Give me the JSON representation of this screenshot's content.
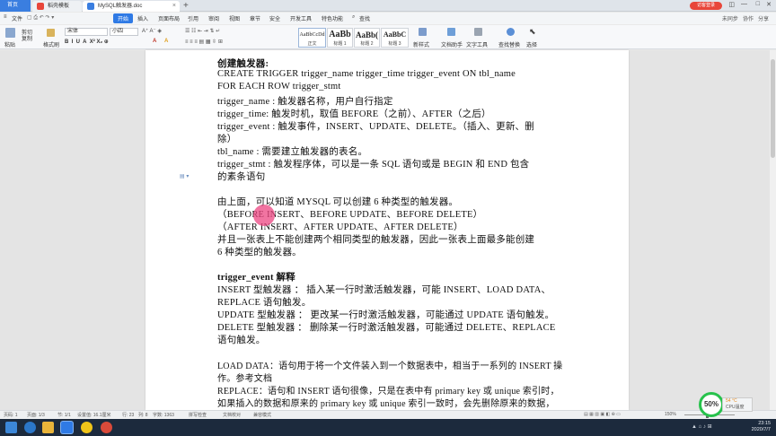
{
  "tabs": {
    "home": "首页",
    "template": "稻壳模板",
    "document": "MySQL触发器.doc"
  },
  "window": {
    "badge": "访客登录"
  },
  "menu": {
    "file": "文件",
    "items": [
      "开始",
      "插入",
      "页面布局",
      "引用",
      "审阅",
      "视图",
      "章节",
      "安全",
      "开发工具",
      "特色功能"
    ],
    "search": "查找",
    "right": [
      "未同步",
      "协作",
      "分享"
    ]
  },
  "ribbon": {
    "paste": "粘贴",
    "cut": "剪切",
    "copy": "复制",
    "format_painter": "格式刷",
    "font_name": "宋体",
    "font_size": "小四",
    "styles": [
      {
        "sample": "AaBbCcDd",
        "name": "正文"
      },
      {
        "sample": "AaBb",
        "name": "标题 1"
      },
      {
        "sample": "AaBb(",
        "name": "标题 2"
      },
      {
        "sample": "AaBbC",
        "name": "标题 3"
      }
    ],
    "new_style": "新样式",
    "doc_assistant": "文档助手",
    "text_tools": "文字工具",
    "find_replace": "查找替换",
    "select": "选择"
  },
  "document": {
    "lines": [
      {
        "text": "创建触发器:",
        "bold": true
      },
      {
        "text": "    CREATE TRIGGER trigger_name trigger_time trigger_event ON tbl_name"
      },
      {
        "text": "FOR EACH ROW trigger_stmt"
      },
      {
        "text": "    trigger_name : 触发器名称，用户自行指定"
      },
      {
        "text": "    trigger_time:  触发时机，取值 BEFORE（之前）、AFTER（之后）"
      },
      {
        "text": "    trigger_event : 触发事件，INSERT、UPDATE、DELETE。（插入、更新、删"
      },
      {
        "text": "除）"
      },
      {
        "text": "    tbl_name : 需要建立触发器的表名。"
      },
      {
        "text": "    trigger_stmt : 触发程序体，可以是一条 SQL 语句或是 BEGIN 和 END 包含"
      },
      {
        "text": "的素条语句"
      },
      {
        "text": ""
      },
      {
        "text": "    由上面，可以知道 MYSQL 可以创建 6 种类型的触发器。"
      },
      {
        "text": "    （BEFORE INSERT、BEFORE UPDATE、BEFORE DELETE）"
      },
      {
        "text": "    （AFTER INSERT、AFTER UPDATE、AFTER DELETE）"
      },
      {
        "text": "    并且一张表上不能创建两个相同类型的触发器，因此一张表上面最多能创建"
      },
      {
        "text": "6 种类型的触发器。"
      },
      {
        "text": ""
      },
      {
        "text": "trigger_event 解释",
        "bold": true
      },
      {
        "text": "    INSERT 型触发器 ： 插入某一行时激活触发器，可能 INSERT、LOAD DATA、"
      },
      {
        "text": "REPLACE 语句触发。"
      },
      {
        "text": "    UPDATE 型触发器 ： 更改某一行时激活触发器，可能通过 UPDATE 语句触发。"
      },
      {
        "text": "    DELETE 型触发器 ：  删除某一行时激活触发器，可能通过 DELETE、REPLACE"
      },
      {
        "text": "语句触发。"
      },
      {
        "text": ""
      },
      {
        "text": "    LOAD DATA：语句用于将一个文件装入到一个数据表中，相当于一系列的 INSERT 操"
      },
      {
        "text": "作。参考文档"
      },
      {
        "text": "    REPLACE：语句和 INSERT 语句很像，只是在表中有 primary key 或 unique 索引时，"
      },
      {
        "text": "如果插入的数据和原来的 primary key 或 unique 索引一致时，会先删除原来的数据，"
      }
    ]
  },
  "status": {
    "page": "页码: 1",
    "pages": "页面: 1/3",
    "section": "节: 1/1",
    "setting": "设置值: 16.1厘米",
    "row": "行: 23",
    "col": "列: 8",
    "words": "字数: 1363",
    "spell": "拼写检查",
    "proof": "文档校对",
    "compat": "兼容模式",
    "zoom": "150%"
  },
  "perf": {
    "percent": "50%",
    "temp": "54 °C",
    "label": "CPU温度"
  },
  "clock": {
    "time": "23:15",
    "date": "2020/7/7"
  },
  "colors": {
    "accent": "#2f7ae5",
    "highlight": "#ec4682",
    "perf_ring": "#27c24c"
  }
}
